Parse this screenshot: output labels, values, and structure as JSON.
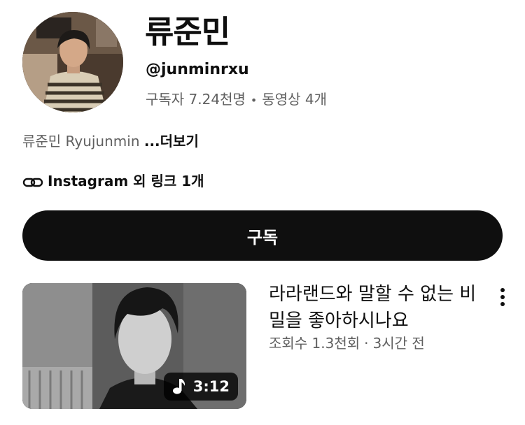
{
  "channel": {
    "name": "류준민",
    "handle": "@junminrxu",
    "subscribers": "구독자 7.24천명",
    "separator": "•",
    "videos": "동영상 4개",
    "description": "류준민 Ryujunmin",
    "more_label": "...더보기",
    "links_label": "Instagram 외 링크 1개"
  },
  "subscribe_label": "구독",
  "video": {
    "title": "라라랜드와 말할 수 없는 비밀을 좋아하시나요",
    "views": "조회수 1.3천회",
    "meta_separator": "·",
    "age": "3시간 전",
    "duration": "3:12"
  },
  "icons": {
    "link": "link-icon",
    "music": "music-note-icon",
    "menu": "more-vert-icon"
  }
}
